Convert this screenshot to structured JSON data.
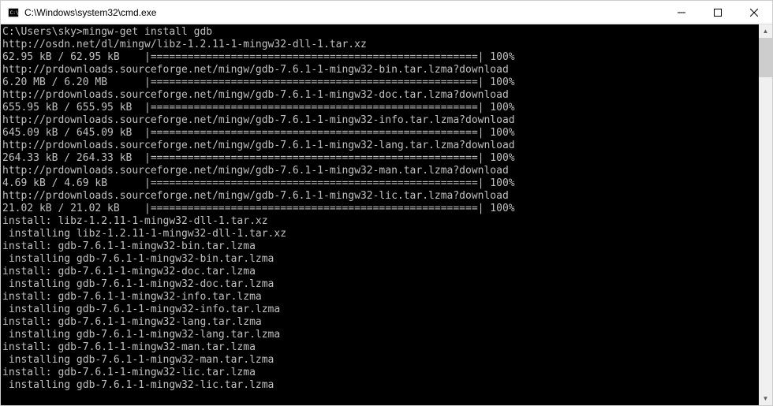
{
  "window": {
    "title": "C:\\Windows\\system32\\cmd.exe"
  },
  "terminal": {
    "prompt": "C:\\Users\\sky>",
    "command": "mingw-get install gdb",
    "lines": [
      "http://osdn.net/dl/mingw/libz-1.2.11-1-mingw32-dll-1.tar.xz",
      "62.95 kB / 62.95 kB    |=====================================================| 100%",
      "http://prdownloads.sourceforge.net/mingw/gdb-7.6.1-1-mingw32-bin.tar.lzma?download",
      "6.20 MB / 6.20 MB      |=====================================================| 100%",
      "http://prdownloads.sourceforge.net/mingw/gdb-7.6.1-1-mingw32-doc.tar.lzma?download",
      "655.95 kB / 655.95 kB  |=====================================================| 100%",
      "http://prdownloads.sourceforge.net/mingw/gdb-7.6.1-1-mingw32-info.tar.lzma?download",
      "645.09 kB / 645.09 kB  |=====================================================| 100%",
      "http://prdownloads.sourceforge.net/mingw/gdb-7.6.1-1-mingw32-lang.tar.lzma?download",
      "264.33 kB / 264.33 kB  |=====================================================| 100%",
      "http://prdownloads.sourceforge.net/mingw/gdb-7.6.1-1-mingw32-man.tar.lzma?download",
      "4.69 kB / 4.69 kB      |=====================================================| 100%",
      "http://prdownloads.sourceforge.net/mingw/gdb-7.6.1-1-mingw32-lic.tar.lzma?download",
      "21.02 kB / 21.02 kB    |=====================================================| 100%",
      "install: libz-1.2.11-1-mingw32-dll-1.tar.xz",
      " installing libz-1.2.11-1-mingw32-dll-1.tar.xz",
      "install: gdb-7.6.1-1-mingw32-bin.tar.lzma",
      " installing gdb-7.6.1-1-mingw32-bin.tar.lzma",
      "install: gdb-7.6.1-1-mingw32-doc.tar.lzma",
      " installing gdb-7.6.1-1-mingw32-doc.tar.lzma",
      "install: gdb-7.6.1-1-mingw32-info.tar.lzma",
      " installing gdb-7.6.1-1-mingw32-info.tar.lzma",
      "install: gdb-7.6.1-1-mingw32-lang.tar.lzma",
      " installing gdb-7.6.1-1-mingw32-lang.tar.lzma",
      "install: gdb-7.6.1-1-mingw32-man.tar.lzma",
      " installing gdb-7.6.1-1-mingw32-man.tar.lzma",
      "install: gdb-7.6.1-1-mingw32-lic.tar.lzma",
      " installing gdb-7.6.1-1-mingw32-lic.tar.lzma"
    ]
  }
}
